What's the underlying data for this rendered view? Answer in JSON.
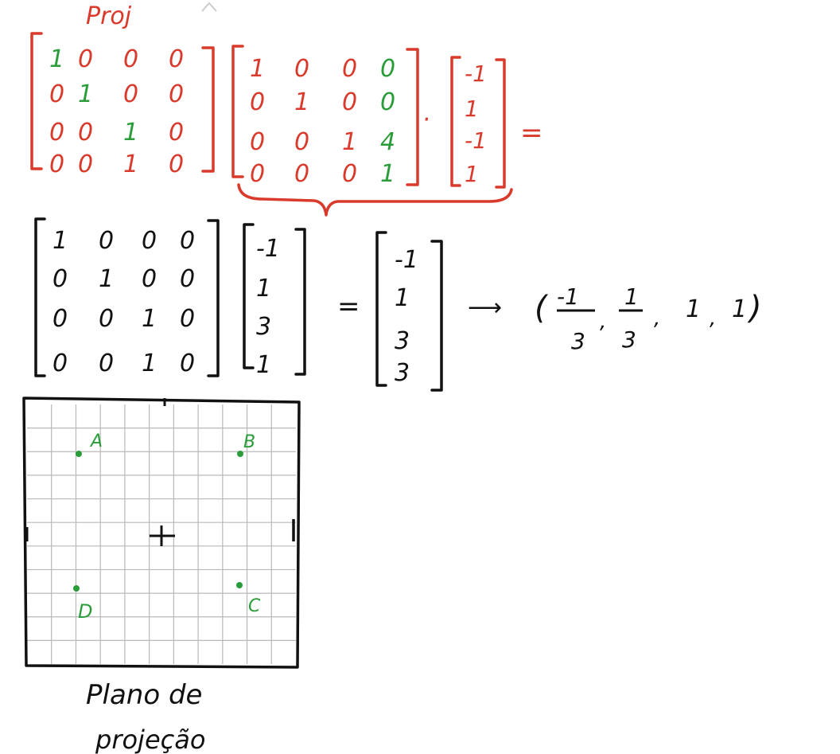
{
  "colors": {
    "red": "#d93a2b",
    "green": "#2a9d3a",
    "ink": "#111111",
    "grid": "#b8b8b8"
  },
  "top_equation": {
    "proj_label": "Proj",
    "matrix_a": [
      [
        "1",
        "0",
        "0",
        "0"
      ],
      [
        "0",
        "1",
        "0",
        "0"
      ],
      [
        "0",
        "0",
        "1",
        "0"
      ],
      [
        "0",
        "0",
        "1",
        "0"
      ]
    ],
    "matrix_a_green": [
      [
        true,
        false,
        false,
        false
      ],
      [
        false,
        true,
        false,
        false
      ],
      [
        false,
        false,
        true,
        false
      ],
      [
        false,
        false,
        false,
        false
      ]
    ],
    "matrix_b": [
      [
        "1",
        "0",
        "0",
        "0"
      ],
      [
        "0",
        "1",
        "0",
        "0"
      ],
      [
        "0",
        "0",
        "1",
        "4"
      ],
      [
        "0",
        "0",
        "0",
        "1"
      ]
    ],
    "matrix_b_green": [
      [
        false,
        false,
        false,
        true
      ],
      [
        false,
        false,
        false,
        true
      ],
      [
        false,
        false,
        false,
        true
      ],
      [
        false,
        false,
        false,
        true
      ]
    ],
    "dot_op": "·",
    "vector": [
      "-1",
      "1",
      "-1",
      "1"
    ],
    "equals": "="
  },
  "second_equation": {
    "matrix": [
      [
        "1",
        "0",
        "0",
        "0"
      ],
      [
        "0",
        "1",
        "0",
        "0"
      ],
      [
        "0",
        "0",
        "1",
        "0"
      ],
      [
        "0",
        "0",
        "1",
        "0"
      ]
    ],
    "vector": [
      "-1",
      "1",
      "3",
      "1"
    ],
    "equals": "=",
    "result": [
      "-1",
      "1",
      "3",
      "3"
    ],
    "arrow": "⟶",
    "tuple": {
      "open": "(",
      "x_num": "-1",
      "x_den": "3",
      "y_num": "1",
      "y_den": "3",
      "z": "1",
      "w": "1",
      "sep": ",",
      "close": ")"
    }
  },
  "plane": {
    "points": {
      "a": "A",
      "b": "B",
      "c": "C",
      "d": "D"
    },
    "caption_line1": "Plano de",
    "caption_line2": "projeção"
  }
}
